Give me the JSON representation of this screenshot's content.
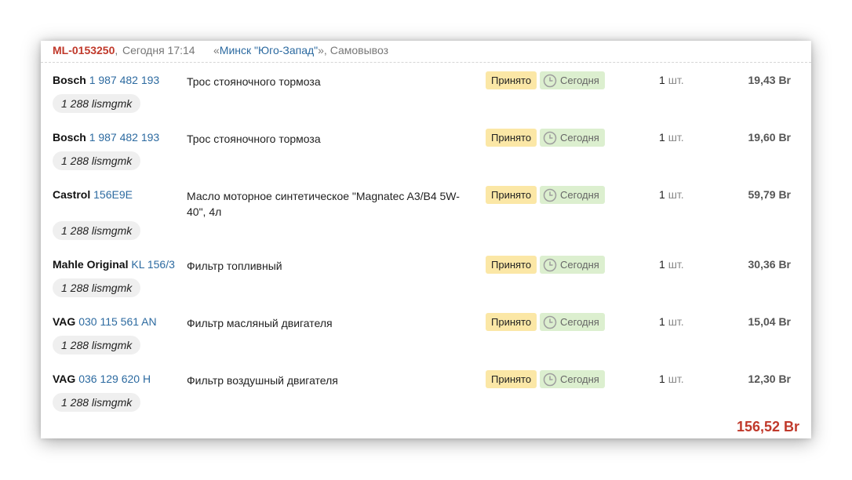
{
  "order": {
    "id": "ML-0153250",
    "separator": ",",
    "time": " Сегодня 17:14",
    "location_prefix": "«",
    "location_name": "Минск \"Юго-Запад\"",
    "location_suffix": "», Самовывоз"
  },
  "items": [
    {
      "brand": "Bosch",
      "article": "1 987 482 193",
      "description": "Трос стояночного тормоза",
      "status": "Принято",
      "date": "Сегодня",
      "qty": "1",
      "unit": "шт.",
      "price": "19,43 Br",
      "supplier": "1 288 lismgmk"
    },
    {
      "brand": "Bosch",
      "article": "1 987 482 193",
      "description": "Трос стояночного тормоза",
      "status": "Принято",
      "date": "Сегодня",
      "qty": "1",
      "unit": "шт.",
      "price": "19,60 Br",
      "supplier": "1 288 lismgmk"
    },
    {
      "brand": "Castrol",
      "article": "156E9E",
      "description": "Масло моторное синтетическое \"Magnatec A3/B4 5W-40\", 4л",
      "status": "Принято",
      "date": "Сегодня",
      "qty": "1",
      "unit": "шт.",
      "price": "59,79 Br",
      "supplier": "1 288 lismgmk"
    },
    {
      "brand": "Mahle Original",
      "article": "KL 156/3",
      "description": "Фильтр топливный",
      "status": "Принято",
      "date": "Сегодня",
      "qty": "1",
      "unit": "шт.",
      "price": "30,36 Br",
      "supplier": "1 288 lismgmk"
    },
    {
      "brand": "VAG",
      "article": "030 115 561 AN",
      "description": "Фильтр масляный двигателя",
      "status": "Принято",
      "date": "Сегодня",
      "qty": "1",
      "unit": "шт.",
      "price": "15,04 Br",
      "supplier": "1 288 lismgmk"
    },
    {
      "brand": "VAG",
      "article": "036 129 620 H",
      "description": "Фильтр воздушный двигателя",
      "status": "Принято",
      "date": "Сегодня",
      "qty": "1",
      "unit": "шт.",
      "price": "12,30 Br",
      "supplier": "1 288 lismgmk"
    }
  ],
  "total": "156,52 Br",
  "icons": {
    "date_badge_icon": "clock-icon"
  },
  "colors": {
    "accent_red": "#c0392b",
    "link_blue": "#2c6aa0",
    "status_yellow": "#fbe7a6",
    "date_green": "#dcefcf"
  }
}
